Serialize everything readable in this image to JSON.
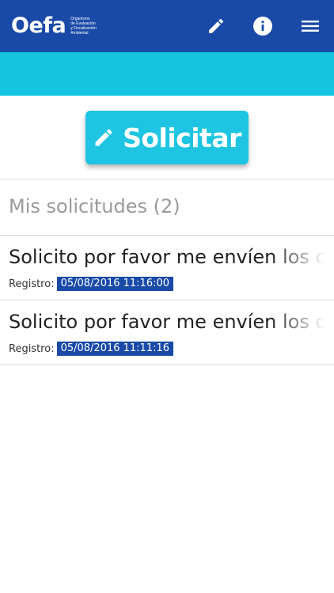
{
  "header": {
    "logo_text": "Oefa",
    "logo_tagline": [
      "Organismo",
      "de Evaluación",
      "y Fiscalización",
      "Ambiental"
    ],
    "icons": [
      "pencil-icon",
      "info-icon",
      "menu-icon"
    ],
    "colors": {
      "header_bg": "#1a4aa8",
      "subbar_bg": "#14c4e0"
    }
  },
  "action": {
    "solicitar_label": "Solicitar",
    "icon": "pencil-icon",
    "color": "#1ec5e2"
  },
  "section": {
    "title": "Mis solicitudes (2)"
  },
  "requests": [
    {
      "text": "Solicito por favor me envíen los documentos",
      "meta_label": "Registro:",
      "date": "05/08/2016 11:16:00"
    },
    {
      "text": "Solicito por favor me envíen los documentos",
      "meta_label": "Registro:",
      "date": "05/08/2016 11:11:16"
    }
  ]
}
